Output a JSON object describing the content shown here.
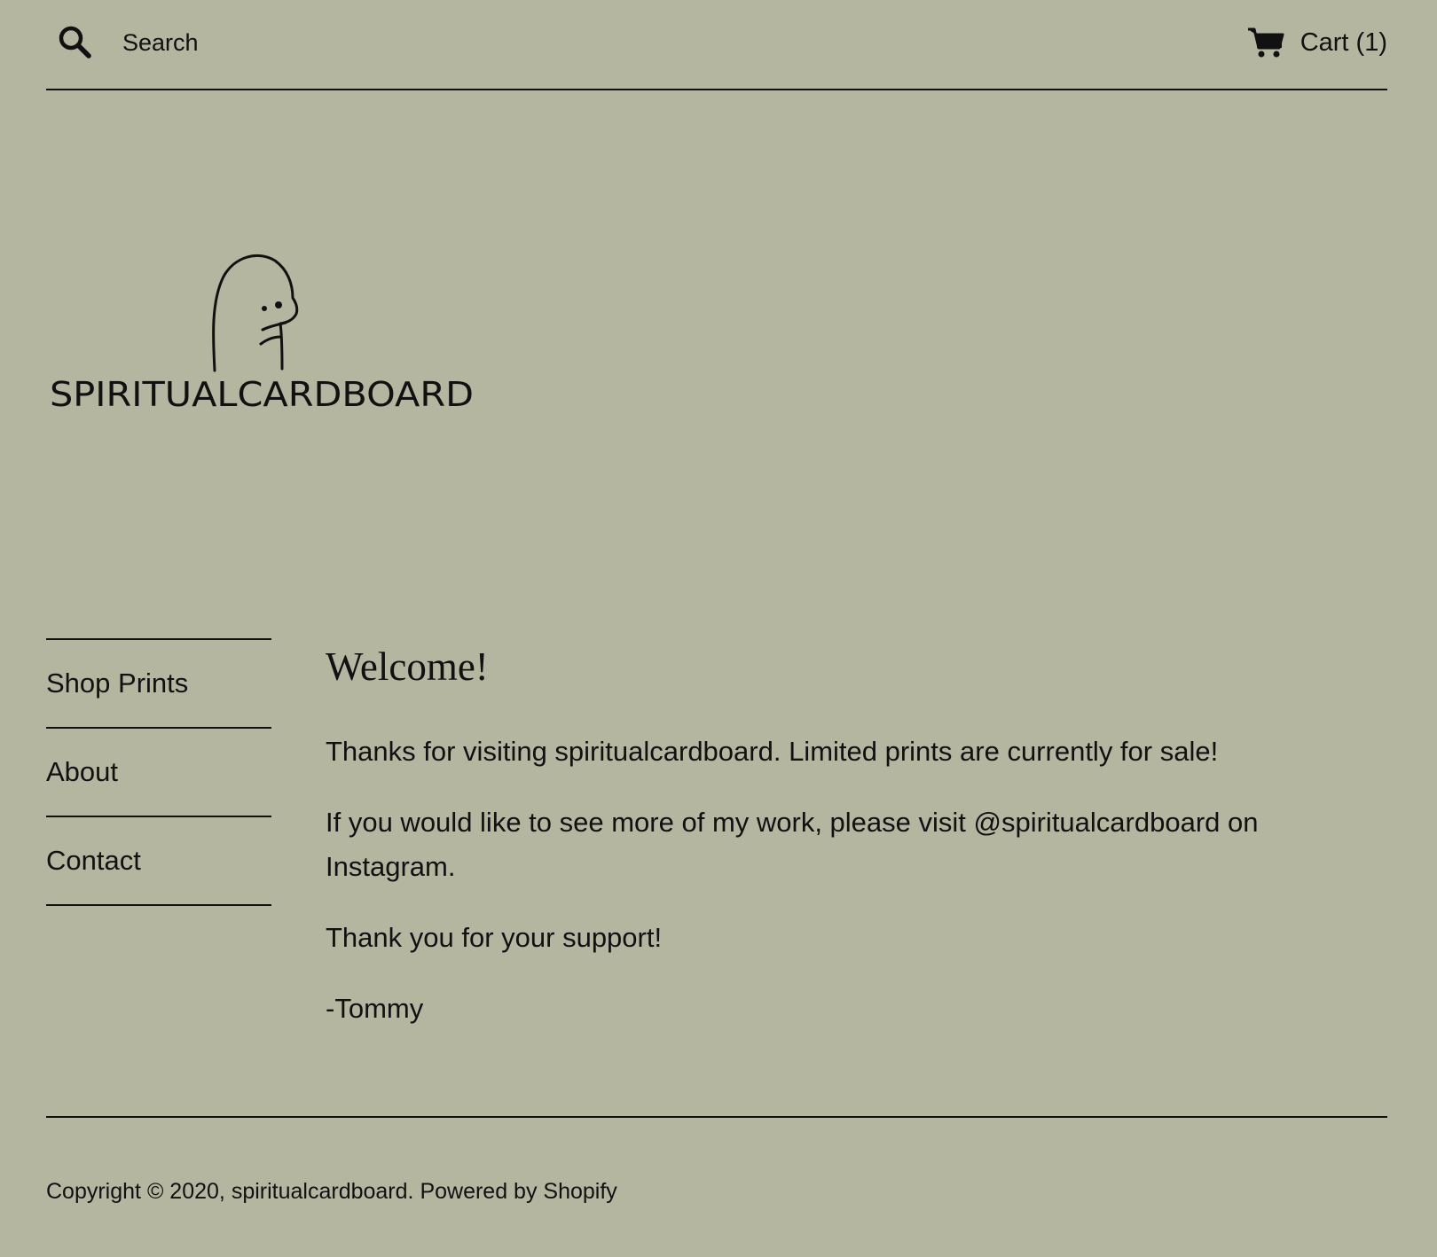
{
  "header": {
    "search_placeholder": "Search",
    "cart_label": "Cart (1)"
  },
  "logo": {
    "text": "SPIRITUALCARDBOARD"
  },
  "nav": {
    "items": [
      {
        "label": "Shop Prints"
      },
      {
        "label": "About"
      },
      {
        "label": "Contact"
      }
    ]
  },
  "main": {
    "title": "Welcome!",
    "paragraphs": [
      "Thanks for visiting spiritualcardboard. Limited prints are currently for sale!",
      "If you would like to see more of my work, please visit @spiritualcardboard on Instagram.",
      "Thank you for your support!",
      "-Tommy"
    ]
  },
  "footer": {
    "copyright": "Copyright © 2020, spiritualcardboard.",
    "powered": "Powered by Shopify"
  },
  "colors": {
    "background": "#b4b6a0",
    "text": "#111111"
  },
  "icons": [
    "search-icon",
    "cart-icon"
  ]
}
